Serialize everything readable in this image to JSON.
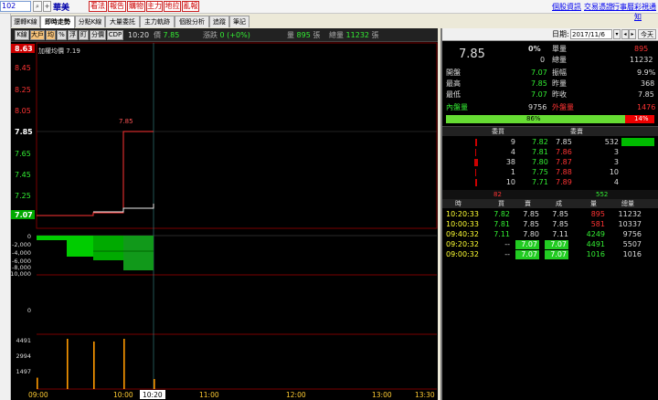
{
  "topbar": {
    "stock_code": "102",
    "stock_name": "華美",
    "red_buttons": [
      "看法",
      "報告",
      "購物",
      "主力",
      "地拉",
      "亂報"
    ],
    "links": [
      "個股資訊",
      "交易憑證",
      "行事曆",
      "彩視通知"
    ]
  },
  "tabs": [
    "還轉K線",
    "即時走勢",
    "分點K線",
    "大量委託",
    "主力軌跡",
    "個股分析",
    "追蹤",
    "筆記"
  ],
  "toolbar": {
    "buttons": [
      "K線",
      "大戶",
      "均",
      "%",
      "浮",
      "盯",
      "分價",
      "CDP"
    ],
    "time": "10:20",
    "price_label": "價",
    "price_value": "7.85",
    "change_label": "漲跌",
    "change_value": "0 (+0%)",
    "volume_label": "量",
    "volume_value": "895",
    "volume_unit": "張",
    "total_label": "總量",
    "total_value": "11232",
    "total_unit": "張"
  },
  "chart_data": {
    "type": "line",
    "title": "",
    "legend": "加權均價 7.19",
    "price_axis": [
      "8.63",
      "8.45",
      "8.25",
      "8.05",
      "7.85",
      "7.65",
      "7.45",
      "7.25",
      "7.07"
    ],
    "diff_axis": [
      "0",
      "-2,000",
      "-4,000",
      "-6,000",
      "-8,000",
      "-10,000"
    ],
    "mid_axis": [
      "0"
    ],
    "vol_axis": [
      "4491",
      "2994",
      "1497"
    ],
    "time_axis": [
      "09:00",
      "10:00",
      "10:20",
      "11:00",
      "12:00",
      "13:00",
      "13:30"
    ],
    "peak_label": "7.85",
    "x": [
      "09:00",
      "09:20",
      "09:40",
      "10:00",
      "10:20"
    ],
    "price": [
      7.07,
      7.07,
      7.11,
      7.85,
      7.85
    ],
    "avg": [
      7.07,
      7.07,
      7.1,
      7.12,
      7.19
    ],
    "volume": [
      1016,
      4491,
      4249,
      10337,
      895
    ],
    "ylim": [
      7.07,
      8.63
    ]
  },
  "quote": {
    "date_label": "日期:",
    "date_value": "2017/11/6",
    "today_btn": "今天",
    "price": "7.85",
    "pct": "0%",
    "zero": "0",
    "single_label": "單量",
    "single_value": "895",
    "total_label": "總量",
    "total_value": "11232",
    "rows": [
      [
        "開盤",
        "7.07",
        "振幅",
        "9.9%"
      ],
      [
        "最高",
        "7.85",
        "昨量",
        "368"
      ],
      [
        "最低",
        "7.07",
        "昨收",
        "7.85"
      ]
    ],
    "inner_label": "內盤量",
    "inner_value": "9756",
    "outer_label": "外盤量",
    "outer_value": "1476",
    "bar_green_pct": "86%",
    "bar_red_pct": "14%",
    "buy_header": "委買",
    "sell_header": "委賣",
    "book": [
      [
        "9",
        "7.82",
        "7.85",
        "532"
      ],
      [
        "4",
        "7.81",
        "7.86",
        "3"
      ],
      [
        "38",
        "7.80",
        "7.87",
        "3"
      ],
      [
        "1",
        "7.75",
        "7.88",
        "10"
      ],
      [
        "10",
        "7.71",
        "7.89",
        "4"
      ]
    ],
    "trade_counts": [
      "82",
      "552"
    ],
    "trade_headers": [
      "時",
      "買",
      "賣",
      "成",
      "量",
      "總量"
    ],
    "trades": [
      [
        "10:20:33",
        "7.82",
        "7.85",
        "7.85",
        "895",
        "11232"
      ],
      [
        "10:00:33",
        "7.81",
        "7.85",
        "7.85",
        "581",
        "10337"
      ],
      [
        "09:40:32",
        "7.11",
        "7.80",
        "7.11",
        "4249",
        "9756"
      ],
      [
        "09:20:32",
        "--",
        "7.07",
        "7.07",
        "4491",
        "5507"
      ],
      [
        "09:00:32",
        "--",
        "7.07",
        "7.07",
        "1016",
        "1016"
      ]
    ]
  }
}
